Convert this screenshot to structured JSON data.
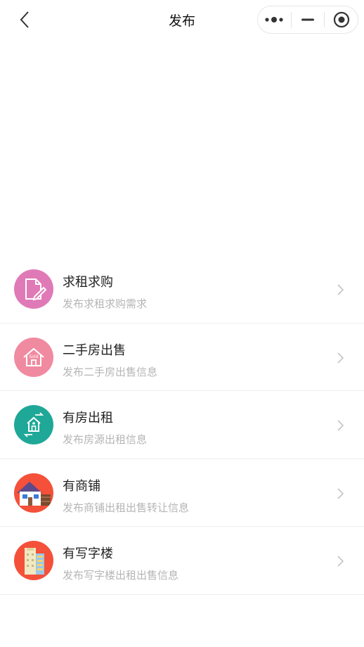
{
  "nav": {
    "title": "发布",
    "back_icon": "chevron-left-icon",
    "capsule": [
      "more-dots-icon",
      "minimize-icon",
      "close-target-icon"
    ]
  },
  "colors": {
    "icon_request": "#e07ab7",
    "icon_sell": "#f08aa0",
    "icon_rent": "#1fa897",
    "icon_shop": "#f4503a",
    "icon_office": "#f4503a"
  },
  "items": [
    {
      "title": "求租求购",
      "desc": "发布求租求购需求",
      "icon": "document-edit-icon"
    },
    {
      "title": "二手房出售",
      "desc": "发布二手房出售信息",
      "icon": "sold-house-icon"
    },
    {
      "title": "有房出租",
      "desc": "发布房源出租信息",
      "icon": "house-exchange-icon"
    },
    {
      "title": "有商铺",
      "desc": "发布商铺出租出售转让信息",
      "icon": "shop-icon"
    },
    {
      "title": "有写字楼",
      "desc": "发布写字楼出租出售信息",
      "icon": "office-building-icon"
    }
  ]
}
